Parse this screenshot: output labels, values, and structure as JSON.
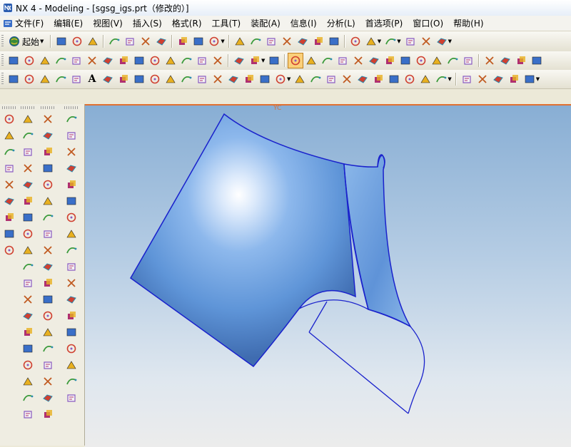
{
  "window": {
    "title": "NX 4 - Modeling - [sgsg_igs.prt（修改的）]"
  },
  "menu": {
    "items": [
      "文件(F)",
      "编辑(E)",
      "视图(V)",
      "插入(S)",
      "格式(R)",
      "工具(T)",
      "装配(A)",
      "信息(I)",
      "分析(L)",
      "首选项(P)",
      "窗口(O)",
      "帮助(H)"
    ]
  },
  "toolbar": {
    "start_label": "起始",
    "start_icon": "start-globe-icon",
    "row1_icons": [
      "new-file-icon",
      "open-folder-icon",
      "save-icon",
      "cut-icon",
      "copy-icon",
      "paste-icon",
      "delete-icon",
      "undo-icon",
      "repeat-icon",
      "selection-filter-icon",
      "fit-view-icon",
      "shaded-view-icon",
      "zoom-window-icon",
      "zoom-icon",
      "rotate-icon",
      "pan-icon",
      "perspective-icon",
      "render-style-icon",
      "display-sphere-icon",
      "lighting-icon",
      "layer-icon",
      "settings-icon",
      "measure-icon"
    ],
    "row2_icons": [
      "sketch-icon",
      "curve-icon",
      "plane-icon",
      "datum-icon",
      "diamond-icon",
      "extrude-icon",
      "revolve-icon",
      "sweep-icon",
      "mesh-icon",
      "chain-icon",
      "boolean-icon",
      "edge-icon",
      "face-icon",
      "blend-icon",
      "chamfer-icon",
      "shell-icon",
      "offset-icon",
      "pin-icon",
      "line-icon",
      "arc-icon",
      "spline-icon",
      "pencil-icon",
      "cross-icon",
      "point-icon",
      "snap-icon",
      "trim-icon",
      "extend-icon",
      "split-icon",
      "fillet-icon",
      "corner-icon",
      "circle-icon",
      "center-icon",
      "target-icon"
    ],
    "row3_icons": [
      "polyline-icon",
      "arc-tool-icon",
      "circle-tool-icon",
      "wave-icon",
      "point-tool-icon",
      "text-icon",
      "point-set-icon",
      "fillet-tool-icon",
      "rectangle-icon",
      "hexagon-icon",
      "ellipse-icon",
      "helix-icon",
      "conic-icon",
      "spiral-icon",
      "project-icon",
      "intersect-icon",
      "section-icon",
      "offset-curve-icon",
      "bridge-icon",
      "join-icon",
      "mirror-icon",
      "scale-icon",
      "wrap-icon",
      "surface-icon",
      "mesh-tool-icon",
      "through-curves-icon",
      "swept-icon",
      "n-sided-icon",
      "patch-icon",
      "analysis-icon",
      "gauge-icon",
      "comb-icon",
      "deviation-icon"
    ],
    "text_icon_glyph": "A"
  },
  "left_toolbar": {
    "col1_icons": [
      "select-icon",
      "arrow-icon",
      "line-tool-icon",
      "curve-tool-icon",
      "spline-tool-icon",
      "branch-icon",
      "circle-point-icon",
      "circle-icon",
      "plus-icon"
    ],
    "col2_icons": [
      "plane-face-icon",
      "face2-icon",
      "face3-icon",
      "cube-red-icon",
      "box-icon",
      "sheet-icon",
      "sheet2-icon",
      "plane-yellow-icon",
      "star-icon",
      "surface-icon",
      "curve-surf-icon",
      "patch-icon",
      "arrow-up-icon",
      "arrow-right-icon",
      "drape-icon",
      "tool-icon",
      "cube2-icon",
      "stitch-icon",
      "cube3-icon"
    ],
    "col3_icons": [
      "solid-green-icon",
      "solid-icon",
      "pad-icon",
      "sphere-icon",
      "cube-yellow-icon",
      "feature-icon",
      "feature2-icon",
      "pocket-icon",
      "slot-icon",
      "rib-icon",
      "cylinder-icon",
      "trim-body-icon",
      "split-body-icon",
      "box3-icon",
      "box4-icon",
      "box5-icon",
      "box6-icon",
      "box7-icon",
      "box8-icon"
    ],
    "col4_icons": [
      "assembly-icon",
      "window-icon",
      "chart-icon",
      "measure2-icon",
      "wire-icon",
      "cube-blue-icon",
      "cube-blue2-icon",
      "cube-blue3-icon",
      "cube-blue4-icon",
      "sphere2-icon",
      "cube-blue5-icon",
      "cylinder2-icon",
      "palette-icon",
      "anchor-icon",
      "pipe-icon",
      "ruler-icon",
      "gear2-icon",
      "tools-icon"
    ]
  },
  "viewport": {
    "axis_label": "YC",
    "model_color": "#6a9edc",
    "edge_color": "#1a22cc"
  }
}
